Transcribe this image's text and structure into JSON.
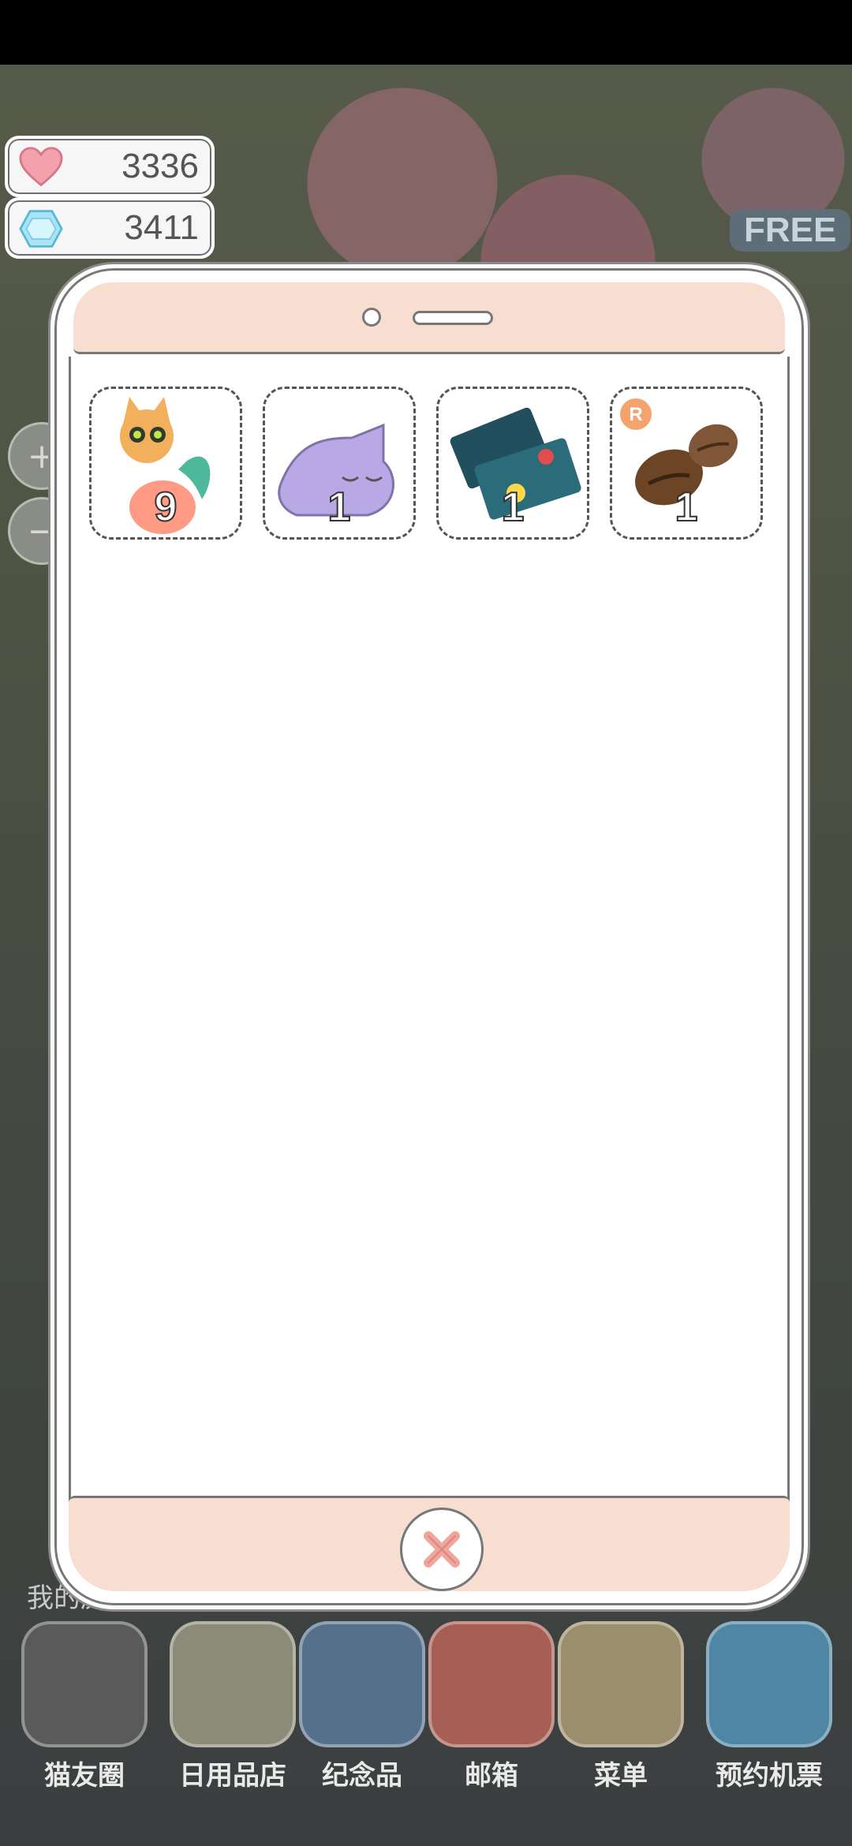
{
  "currencies": {
    "hearts": {
      "icon": "heart-icon",
      "value": "3336"
    },
    "gems": {
      "icon": "diamond-icon",
      "value": "3411"
    }
  },
  "background": {
    "free_label": "FREE",
    "left_label": "我的房"
  },
  "inventory": {
    "items": [
      {
        "name": "cat-with-fish-toy",
        "qty": "9"
      },
      {
        "name": "sleeping-purple-cat",
        "qty": "1"
      },
      {
        "name": "tickets",
        "qty": "1"
      },
      {
        "name": "coffee-beans",
        "badge": "R",
        "qty": "1"
      }
    ]
  },
  "dialog": {
    "close_icon": "close-icon"
  },
  "bottom_nav": {
    "items": [
      {
        "label": "猫友圈",
        "color": "#5a5a5a"
      },
      {
        "label": "日用品店",
        "color": "#8b8b78"
      },
      {
        "label": "纪念品",
        "color": "#56708c"
      },
      {
        "label": "邮箱",
        "color": "#a65e55"
      },
      {
        "label": "菜单",
        "color": "#9a8e6d"
      },
      {
        "label": "预约机票",
        "color": "#4f86a3"
      }
    ]
  }
}
